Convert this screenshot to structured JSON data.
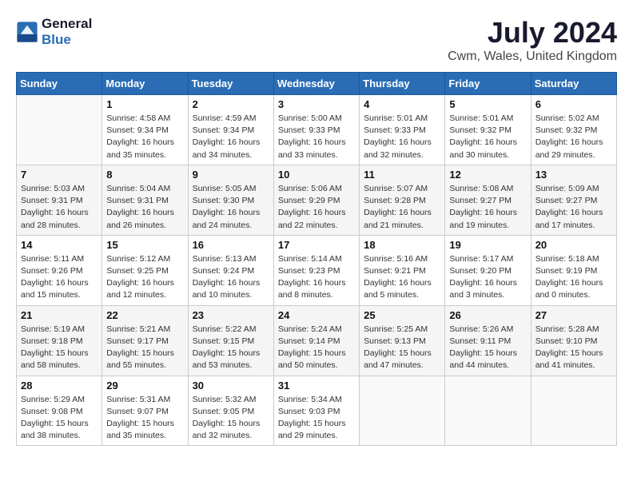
{
  "logo": {
    "line1": "General",
    "line2": "Blue"
  },
  "title": "July 2024",
  "location": "Cwm, Wales, United Kingdom",
  "days_of_week": [
    "Sunday",
    "Monday",
    "Tuesday",
    "Wednesday",
    "Thursday",
    "Friday",
    "Saturday"
  ],
  "weeks": [
    [
      {
        "day": "",
        "info": ""
      },
      {
        "day": "1",
        "info": "Sunrise: 4:58 AM\nSunset: 9:34 PM\nDaylight: 16 hours\nand 35 minutes."
      },
      {
        "day": "2",
        "info": "Sunrise: 4:59 AM\nSunset: 9:34 PM\nDaylight: 16 hours\nand 34 minutes."
      },
      {
        "day": "3",
        "info": "Sunrise: 5:00 AM\nSunset: 9:33 PM\nDaylight: 16 hours\nand 33 minutes."
      },
      {
        "day": "4",
        "info": "Sunrise: 5:01 AM\nSunset: 9:33 PM\nDaylight: 16 hours\nand 32 minutes."
      },
      {
        "day": "5",
        "info": "Sunrise: 5:01 AM\nSunset: 9:32 PM\nDaylight: 16 hours\nand 30 minutes."
      },
      {
        "day": "6",
        "info": "Sunrise: 5:02 AM\nSunset: 9:32 PM\nDaylight: 16 hours\nand 29 minutes."
      }
    ],
    [
      {
        "day": "7",
        "info": "Sunrise: 5:03 AM\nSunset: 9:31 PM\nDaylight: 16 hours\nand 28 minutes."
      },
      {
        "day": "8",
        "info": "Sunrise: 5:04 AM\nSunset: 9:31 PM\nDaylight: 16 hours\nand 26 minutes."
      },
      {
        "day": "9",
        "info": "Sunrise: 5:05 AM\nSunset: 9:30 PM\nDaylight: 16 hours\nand 24 minutes."
      },
      {
        "day": "10",
        "info": "Sunrise: 5:06 AM\nSunset: 9:29 PM\nDaylight: 16 hours\nand 22 minutes."
      },
      {
        "day": "11",
        "info": "Sunrise: 5:07 AM\nSunset: 9:28 PM\nDaylight: 16 hours\nand 21 minutes."
      },
      {
        "day": "12",
        "info": "Sunrise: 5:08 AM\nSunset: 9:27 PM\nDaylight: 16 hours\nand 19 minutes."
      },
      {
        "day": "13",
        "info": "Sunrise: 5:09 AM\nSunset: 9:27 PM\nDaylight: 16 hours\nand 17 minutes."
      }
    ],
    [
      {
        "day": "14",
        "info": "Sunrise: 5:11 AM\nSunset: 9:26 PM\nDaylight: 16 hours\nand 15 minutes."
      },
      {
        "day": "15",
        "info": "Sunrise: 5:12 AM\nSunset: 9:25 PM\nDaylight: 16 hours\nand 12 minutes."
      },
      {
        "day": "16",
        "info": "Sunrise: 5:13 AM\nSunset: 9:24 PM\nDaylight: 16 hours\nand 10 minutes."
      },
      {
        "day": "17",
        "info": "Sunrise: 5:14 AM\nSunset: 9:23 PM\nDaylight: 16 hours\nand 8 minutes."
      },
      {
        "day": "18",
        "info": "Sunrise: 5:16 AM\nSunset: 9:21 PM\nDaylight: 16 hours\nand 5 minutes."
      },
      {
        "day": "19",
        "info": "Sunrise: 5:17 AM\nSunset: 9:20 PM\nDaylight: 16 hours\nand 3 minutes."
      },
      {
        "day": "20",
        "info": "Sunrise: 5:18 AM\nSunset: 9:19 PM\nDaylight: 16 hours\nand 0 minutes."
      }
    ],
    [
      {
        "day": "21",
        "info": "Sunrise: 5:19 AM\nSunset: 9:18 PM\nDaylight: 15 hours\nand 58 minutes."
      },
      {
        "day": "22",
        "info": "Sunrise: 5:21 AM\nSunset: 9:17 PM\nDaylight: 15 hours\nand 55 minutes."
      },
      {
        "day": "23",
        "info": "Sunrise: 5:22 AM\nSunset: 9:15 PM\nDaylight: 15 hours\nand 53 minutes."
      },
      {
        "day": "24",
        "info": "Sunrise: 5:24 AM\nSunset: 9:14 PM\nDaylight: 15 hours\nand 50 minutes."
      },
      {
        "day": "25",
        "info": "Sunrise: 5:25 AM\nSunset: 9:13 PM\nDaylight: 15 hours\nand 47 minutes."
      },
      {
        "day": "26",
        "info": "Sunrise: 5:26 AM\nSunset: 9:11 PM\nDaylight: 15 hours\nand 44 minutes."
      },
      {
        "day": "27",
        "info": "Sunrise: 5:28 AM\nSunset: 9:10 PM\nDaylight: 15 hours\nand 41 minutes."
      }
    ],
    [
      {
        "day": "28",
        "info": "Sunrise: 5:29 AM\nSunset: 9:08 PM\nDaylight: 15 hours\nand 38 minutes."
      },
      {
        "day": "29",
        "info": "Sunrise: 5:31 AM\nSunset: 9:07 PM\nDaylight: 15 hours\nand 35 minutes."
      },
      {
        "day": "30",
        "info": "Sunrise: 5:32 AM\nSunset: 9:05 PM\nDaylight: 15 hours\nand 32 minutes."
      },
      {
        "day": "31",
        "info": "Sunrise: 5:34 AM\nSunset: 9:03 PM\nDaylight: 15 hours\nand 29 minutes."
      },
      {
        "day": "",
        "info": ""
      },
      {
        "day": "",
        "info": ""
      },
      {
        "day": "",
        "info": ""
      }
    ]
  ]
}
